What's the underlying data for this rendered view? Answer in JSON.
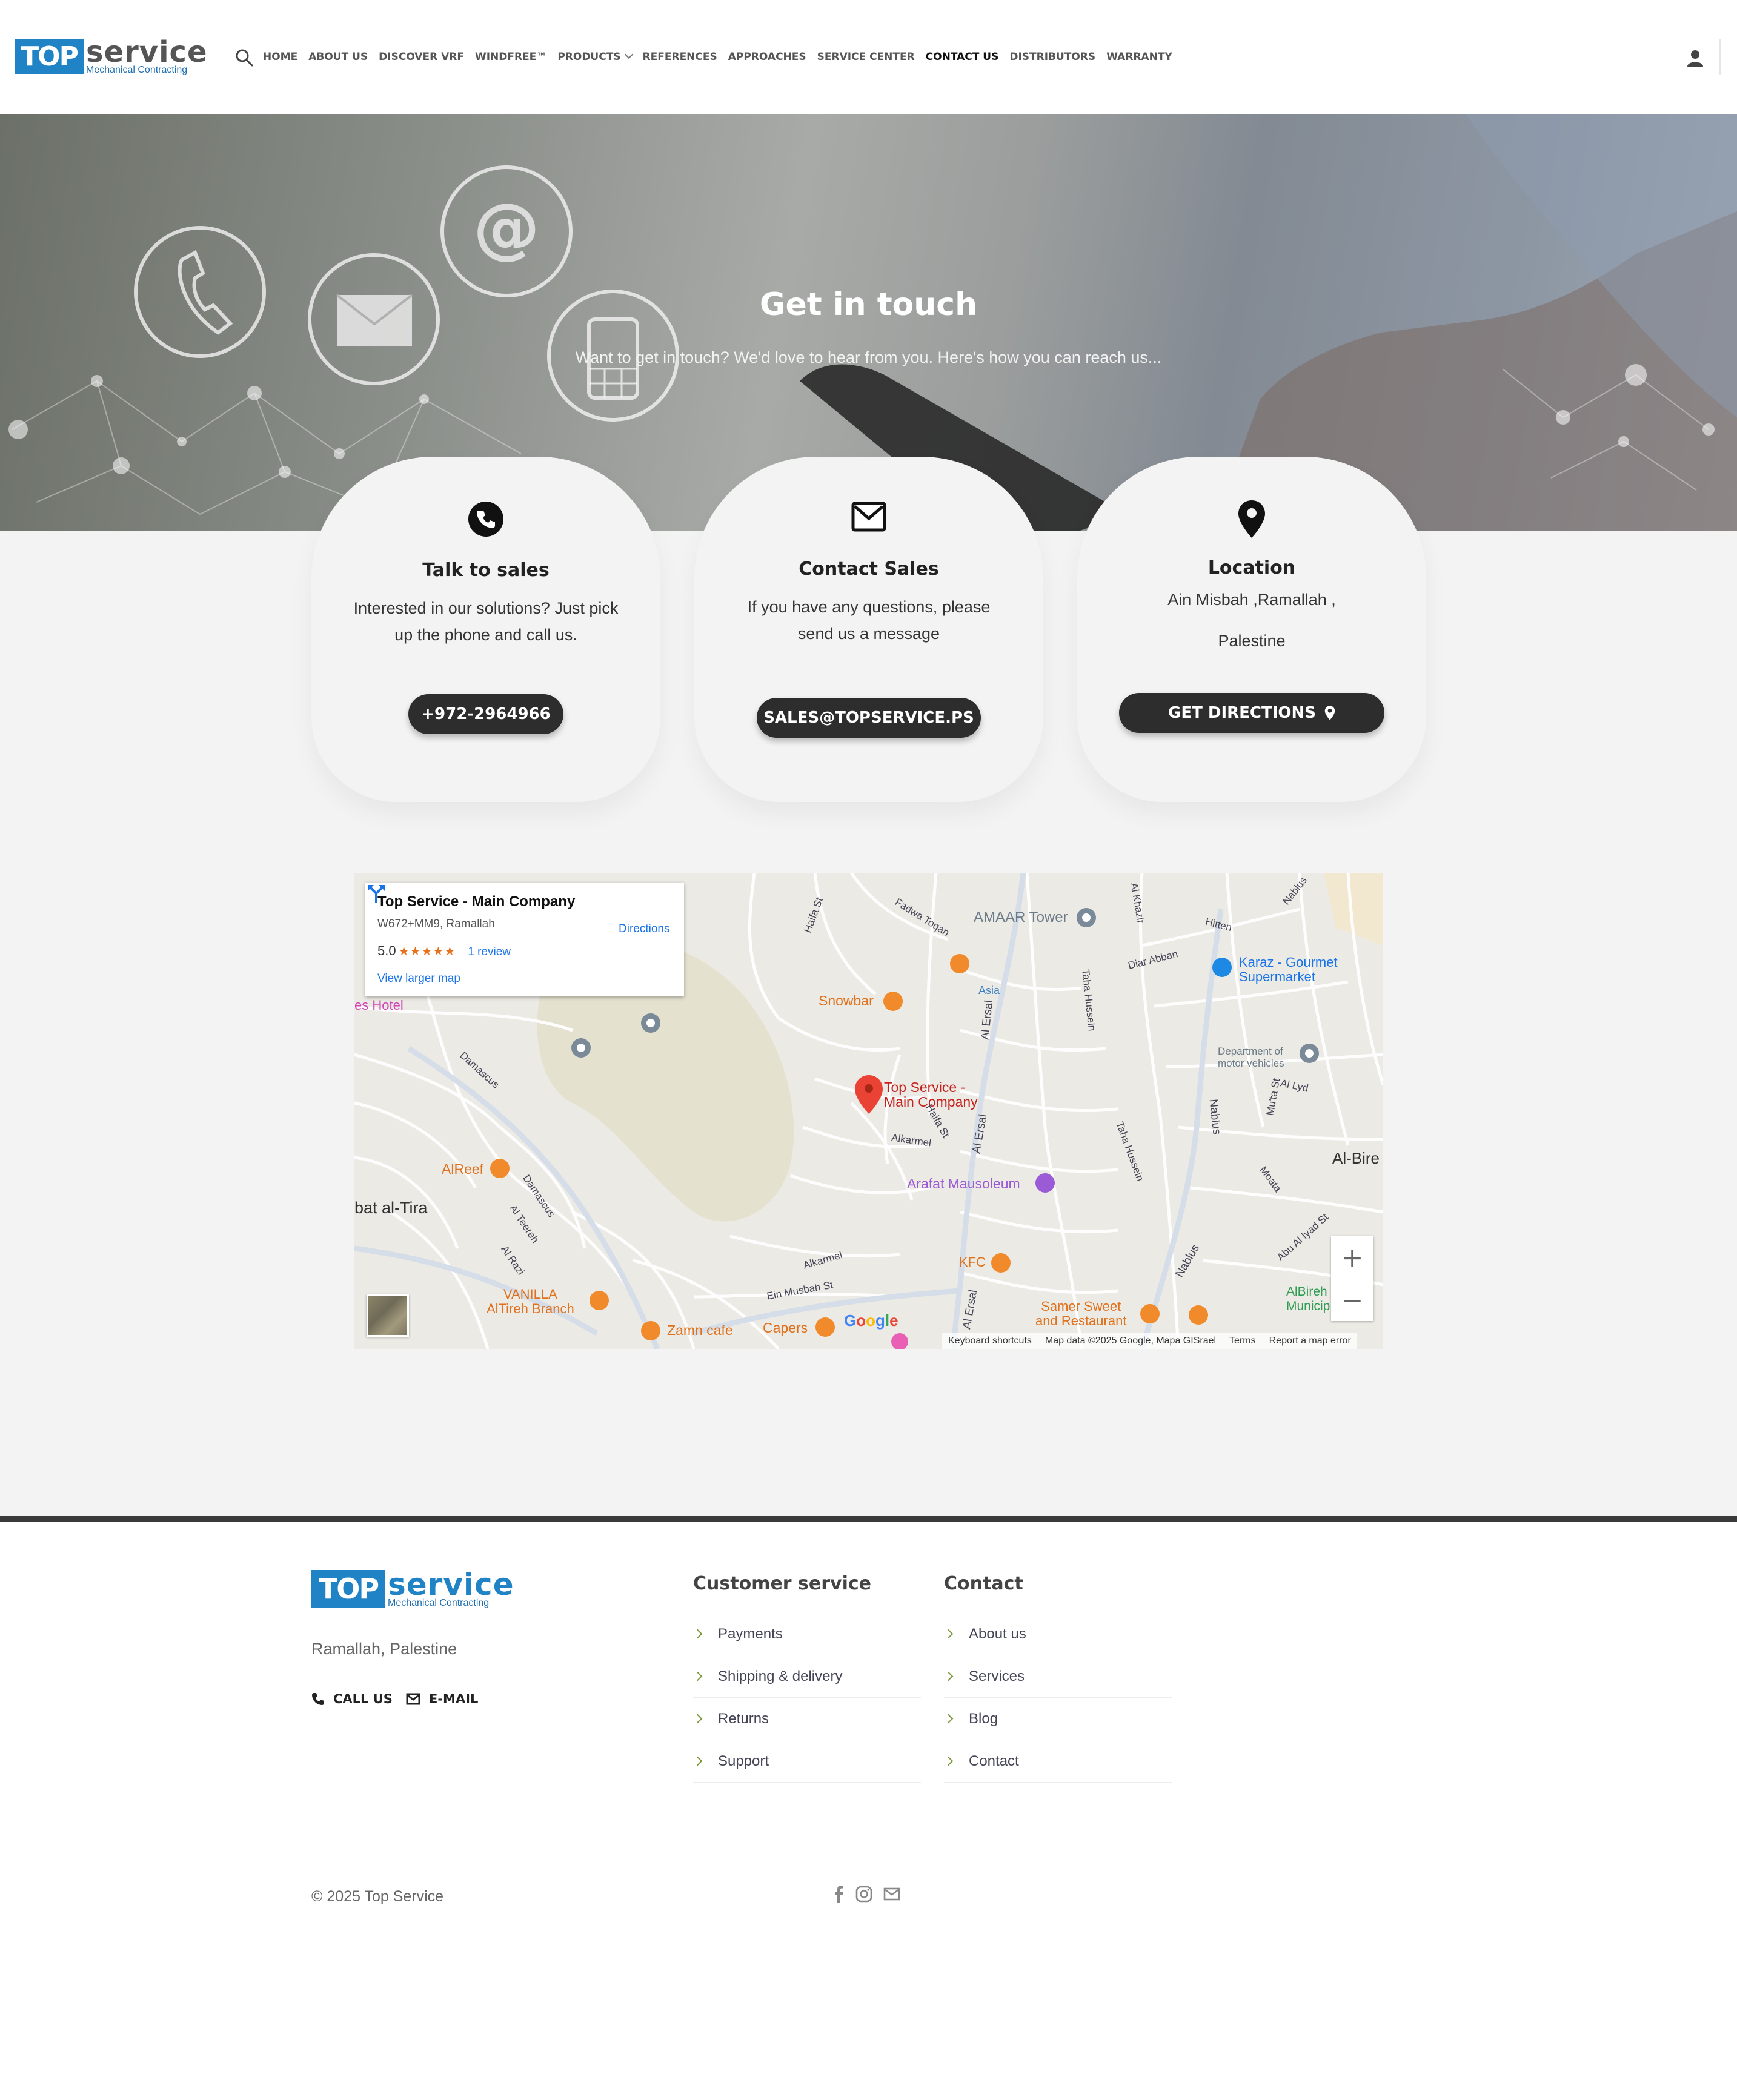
{
  "header": {
    "logo": {
      "mark": "TOP",
      "word": "service",
      "subtitle": "Mechanical Contracting"
    },
    "nav": [
      {
        "label": "HOME"
      },
      {
        "label": "ABOUT US"
      },
      {
        "label": "DISCOVER VRF"
      },
      {
        "label": "WINDFREE™"
      },
      {
        "label": "PRODUCTS"
      },
      {
        "label": "REFERENCES"
      },
      {
        "label": "APPROACHES"
      },
      {
        "label": "SERVICE CENTER"
      },
      {
        "label": "CONTACT US",
        "active": true
      },
      {
        "label": "DISTRIBUTORS"
      },
      {
        "label": "WARRANTY"
      }
    ],
    "icons": [
      "search-icon",
      "user-icon",
      "chevron-down-icon"
    ]
  },
  "hero": {
    "title": "Get in touch",
    "subtitle": "Want to get in touch? We'd love to hear from you. Here's how you can reach us..."
  },
  "cards": [
    {
      "icon": "phone-icon",
      "title": "Talk to sales",
      "text": "Interested in our solutions? Just pick up the phone and call us.",
      "button": "+972-2964966"
    },
    {
      "icon": "envelope-icon",
      "title": "Contact Sales",
      "text": "If you have any questions, please send us a message",
      "button": "SALES@TOPSERVICE.PS"
    },
    {
      "icon": "map-pin-icon",
      "title": "Location",
      "line1": "Ain Misbah ,Ramallah ,",
      "line2": "Palestine",
      "button": "GET DIRECTIONS"
    }
  ],
  "map": {
    "place_name": "Top Service - Main Company",
    "address": "W672+MM9, Ramallah",
    "rating": "5.0",
    "stars": "★★★★★",
    "reviews": "1 review",
    "larger_map": "View larger map",
    "directions": "Directions",
    "marker_label_1": "Top Service -",
    "marker_label_2": "Main Company",
    "labels": {
      "amaar": "AMAAR Tower",
      "karaz1": "Karaz - Gourmet",
      "karaz2": "Supermarket",
      "snowbar": "Snowbar",
      "asia": "Asia",
      "hotel": "es Hotel",
      "dept1": "Department of",
      "dept2": "motor vehicles",
      "albire": "Al-Bire",
      "arafat": "Arafat Mausoleum",
      "alreef": "AlReef",
      "tira": "bat al-Tira",
      "kfc": "KFC",
      "vanilla1": "VANILLA",
      "vanilla2": "AlTireh Branch",
      "zamn": "Zamn cafe",
      "capers": "Capers",
      "samer1": "Samer Sweet",
      "samer2": "and Restaurant",
      "albireh1": "AlBireh",
      "albireh2": "Municip",
      "haifa": "Haifa St",
      "fadwa": "Fadwa Toqan",
      "alkhazir": "Al Khazir",
      "hitten": "Hitten",
      "nablus_top": "Nablus",
      "diar": "Diar Abban",
      "alersal": "Al Ersal",
      "taha": "Taha Hussein",
      "nablus_mid": "Nablus",
      "muta": "Mu'ta St",
      "allyd": "Al Lyd",
      "damascus": "Damascus",
      "haifa2": "Haifa St",
      "alkarmel": "Alkarmel",
      "aljalal": "Al Ersal",
      "alteereh": "Al Teereh",
      "alrazi": "Al Razi",
      "ainmusbah": "Ein Musbah St",
      "alkarmel2": "Alkarmel",
      "abuiyad": "Abu Al Iyad St",
      "moata": "Moata"
    },
    "google": "Google",
    "footer": [
      "Keyboard shortcuts",
      "Map data ©2025 Google, Mapa GISrael",
      "Terms",
      "Report a map error"
    ],
    "zoom_in": "+",
    "zoom_out": "−"
  },
  "footer": {
    "logo": {
      "mark": "TOP",
      "word": "service",
      "subtitle": "Mechanical Contracting"
    },
    "location": "Ramallah, Palestine",
    "call_us": "CALL US",
    "email": "E-MAIL",
    "customer_service": {
      "title": "Customer service",
      "items": [
        "Payments",
        "Shipping & delivery",
        "Returns",
        "Support"
      ]
    },
    "contact": {
      "title": "Contact",
      "items": [
        "About us",
        "Services",
        "Blog",
        "Contact"
      ]
    },
    "copyright": "© 2025 Top Service",
    "social": [
      "facebook-icon",
      "instagram-icon",
      "email-icon"
    ]
  },
  "colors": {
    "brand_blue": "#1f83c6",
    "brand_green": "#8cc43f",
    "button_dark": "#2d2d2d",
    "page_grey": "#f3f3f3",
    "map_marker": "#ea4335",
    "map_orange": "#f08a2a"
  }
}
